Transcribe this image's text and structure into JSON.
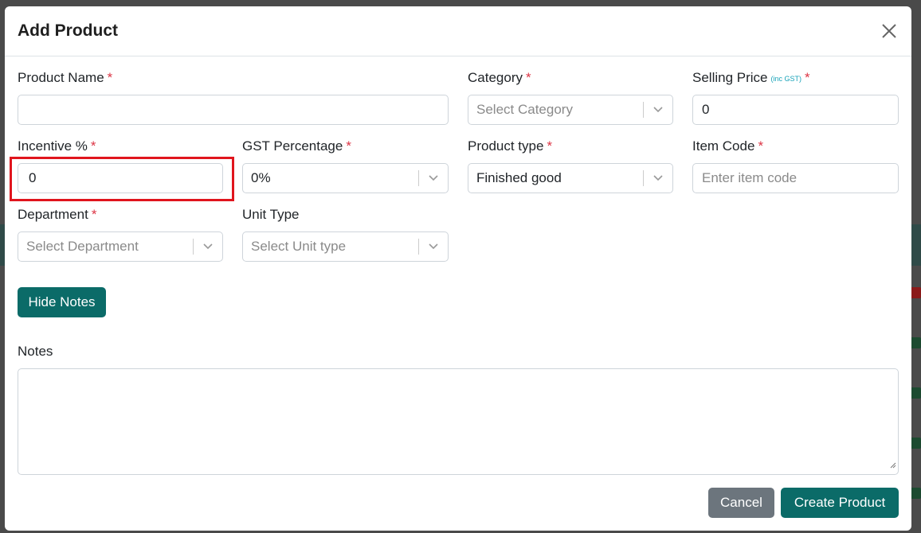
{
  "modal": {
    "title": "Add Product",
    "close_icon": "close-icon"
  },
  "fields": {
    "product_name": {
      "label": "Product Name",
      "required": "*",
      "value": ""
    },
    "category": {
      "label": "Category",
      "required": "*",
      "placeholder": "Select Category"
    },
    "selling_price": {
      "label": "Selling Price",
      "note": "(inc GST)",
      "required": "*",
      "value": "0"
    },
    "incentive": {
      "label": "Incentive %",
      "required": "*",
      "value": "0"
    },
    "gst": {
      "label": "GST Percentage",
      "required": "*",
      "value": "0%"
    },
    "product_type": {
      "label": "Product type",
      "required": "*",
      "value": "Finished good"
    },
    "item_code": {
      "label": "Item Code",
      "required": "*",
      "placeholder": "Enter item code"
    },
    "department": {
      "label": "Department",
      "required": "*",
      "placeholder": "Select Department"
    },
    "unit_type": {
      "label": "Unit Type",
      "placeholder": "Select Unit type"
    },
    "notes": {
      "label": "Notes",
      "value": ""
    }
  },
  "buttons": {
    "hide_notes": "Hide Notes",
    "cancel": "Cancel",
    "create": "Create Product"
  },
  "colors": {
    "accent": "#0b6b68",
    "required": "#dc3545",
    "highlight": "#e0151d",
    "cancel": "#6c757d"
  }
}
